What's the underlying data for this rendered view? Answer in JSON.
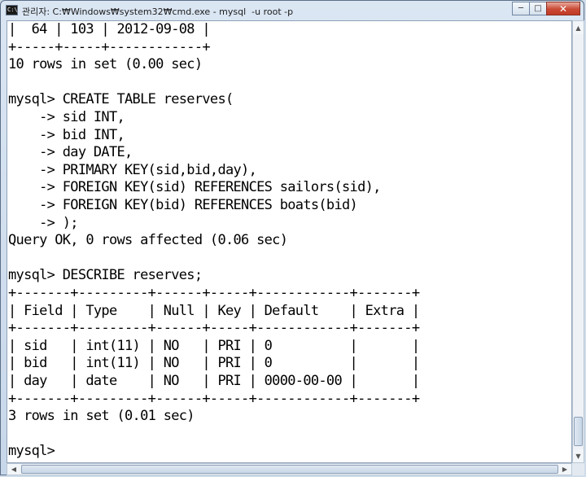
{
  "window": {
    "title": "관리자: C:₩Windows₩system32₩cmd.exe - mysql  -u root -p",
    "app_icon_label": "C:\\",
    "buttons": {
      "minimize": "─",
      "maximize": "□",
      "close": "✕"
    }
  },
  "console": {
    "lines": [
      "|  64 | 103 | 2012-09-08 |",
      "+-----+-----+------------+",
      "10 rows in set (0.00 sec)",
      "",
      "mysql> CREATE TABLE reserves(",
      "    -> sid INT,",
      "    -> bid INT,",
      "    -> day DATE,",
      "    -> PRIMARY KEY(sid,bid,day),",
      "    -> FOREIGN KEY(sid) REFERENCES sailors(sid),",
      "    -> FOREIGN KEY(bid) REFERENCES boats(bid)",
      "    -> );",
      "Query OK, 0 rows affected (0.06 sec)",
      "",
      "mysql> DESCRIBE reserves;",
      "+-------+---------+------+-----+------------+-------+",
      "| Field | Type    | Null | Key | Default    | Extra |",
      "+-------+---------+------+-----+------------+-------+",
      "| sid   | int(11) | NO   | PRI | 0          |       |",
      "| bid   | int(11) | NO   | PRI | 0          |       |",
      "| day   | date    | NO   | PRI | 0000-00-00 |       |",
      "+-------+---------+------+-----+------------+-------+",
      "3 rows in set (0.01 sec)",
      "",
      "mysql>"
    ]
  },
  "scrollbars": {
    "up_arrow": "▲",
    "down_arrow": "▼",
    "left_arrow": "◀",
    "right_arrow": "▶"
  }
}
